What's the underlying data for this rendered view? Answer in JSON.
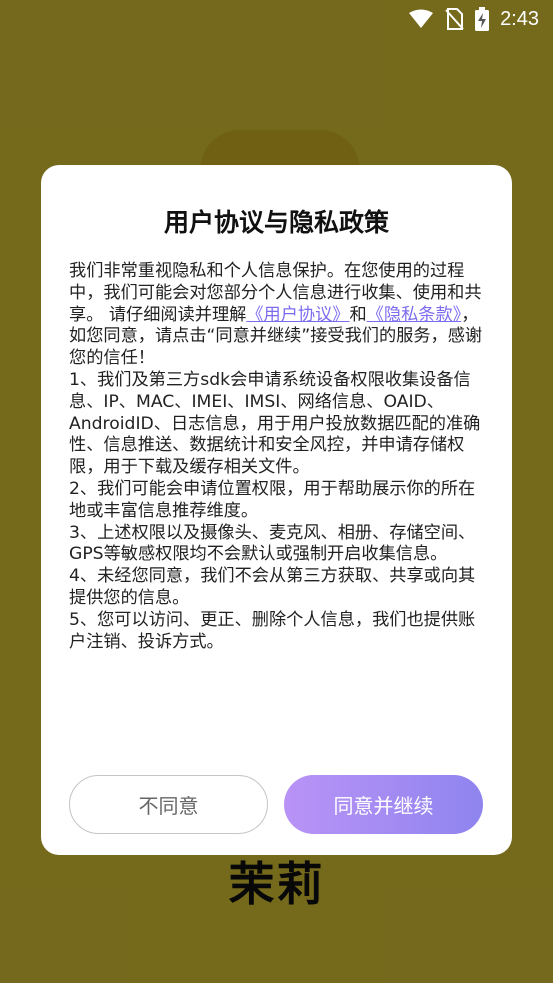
{
  "app": {
    "name": "茉莉"
  },
  "status_bar": {
    "time": "2:43",
    "icons": [
      "wifi-icon",
      "no-sim-icon",
      "battery-charging-icon"
    ]
  },
  "dialog": {
    "title": "用户协议与隐私政策",
    "intro_part1": "我们非常重视隐私和个人信息保护。在您使用的过程中，我们可能会对您部分个人信息进行收集、使用和共享。 请仔细阅读并理解",
    "link_user_agreement": "《用户协议》",
    "intro_and": "和",
    "link_privacy_policy": "《隐私条款》",
    "intro_part2": "，如您同意，请点击“同意并继续”接受我们的服务，感谢您的信任！",
    "items": [
      "1、我们及第三方sdk会申请系统设备权限收集设备信息、IP、MAC、IMEI、IMSI、网络信息、OAID、AndroidID、日志信息，用于用户投放数据匹配的准确性、信息推送、数据统计和安全风控，并申请存储权限，用于下载及缓存相关文件。",
      "2、我们可能会申请位置权限，用于帮助展示你的所在地或丰富信息推荐维度。",
      "3、上述权限以及摄像头、麦克风、相册、存储空间、GPS等敏感权限均不会默认或强制开启收集信息。",
      "4、未经您同意，我们不会从第三方获取、共享或向其提供您的信息。",
      "5、您可以访问、更正、删除个人信息，我们也提供账户注销、投诉方式。"
    ],
    "disagree_label": "不同意",
    "agree_label": "同意并继续"
  },
  "colors": {
    "background": "#f4dc3c",
    "link": "#7b6cf0",
    "agree_gradient_start": "#b993f6",
    "agree_gradient_end": "#8f84ef"
  }
}
